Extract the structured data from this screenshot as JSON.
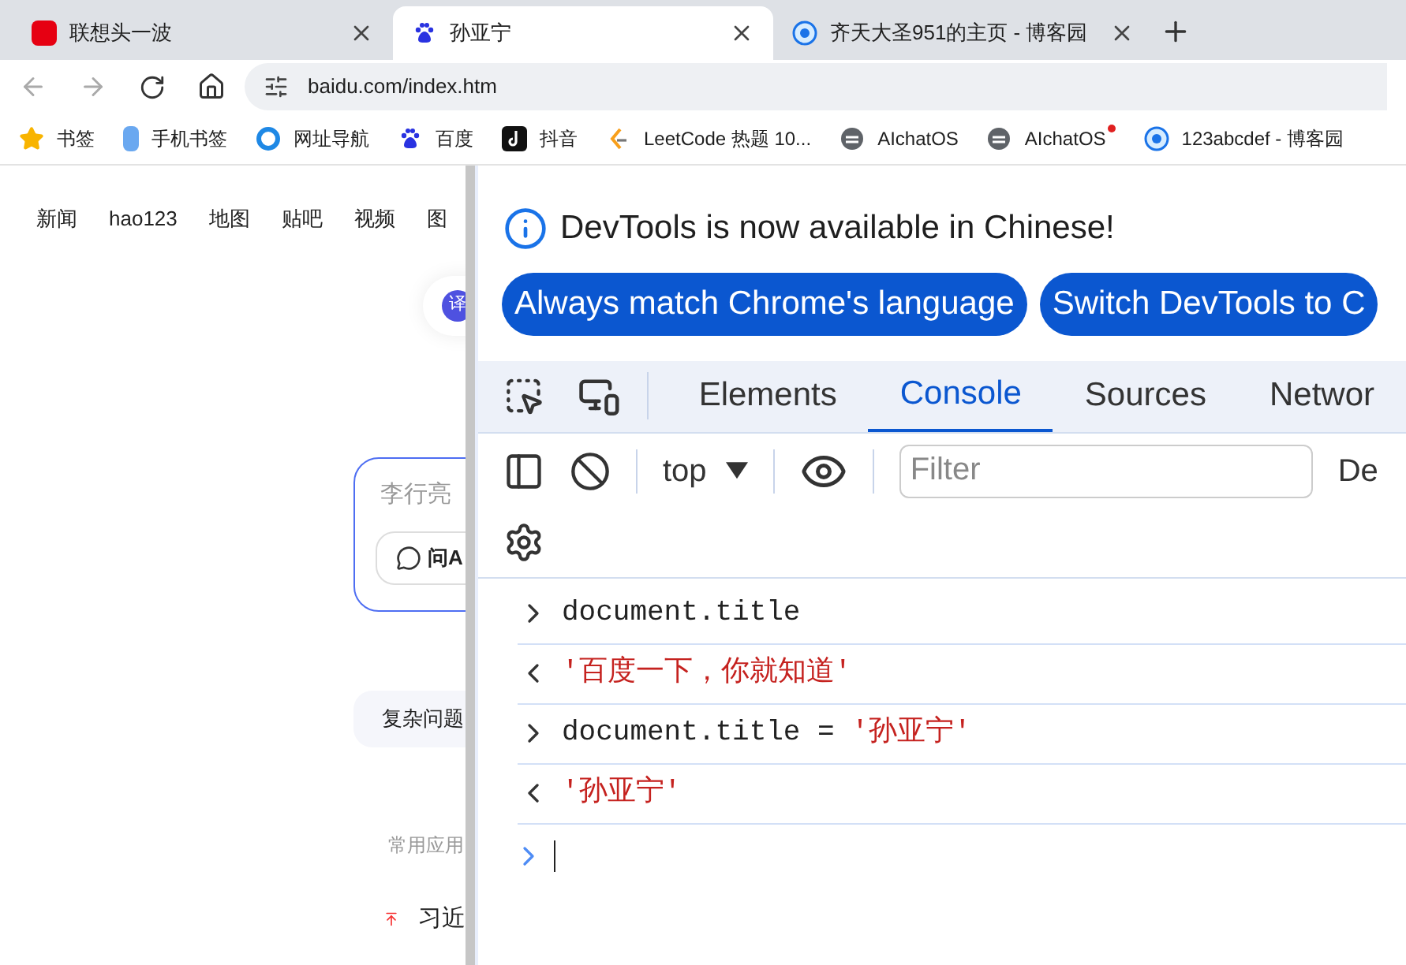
{
  "tabs": [
    {
      "title": "联想头一波",
      "kind": "red-square",
      "selected": false
    },
    {
      "title": "孙亚宁",
      "kind": "paw",
      "selected": true
    },
    {
      "title": "齐天大圣951的主页 - 博客园",
      "kind": "blue-ring",
      "selected": false
    }
  ],
  "address": "baidu.com/index.htm",
  "bookmarks": [
    {
      "label": "书签",
      "kind": "star",
      "dot": false
    },
    {
      "label": "手机书签",
      "kind": "phone",
      "dot": false
    },
    {
      "label": "网址导航",
      "kind": "swirl",
      "dot": false
    },
    {
      "label": "百度",
      "kind": "paw",
      "dot": false
    },
    {
      "label": "抖音",
      "kind": "note",
      "dot": false
    },
    {
      "label": "LeetCode 热题 10...",
      "kind": "bracket",
      "dot": false
    },
    {
      "label": "AIchatOS",
      "kind": "grey-swirl",
      "dot": false
    },
    {
      "label": "AIchatOS",
      "kind": "grey-swirl",
      "dot": true
    },
    {
      "label": "123abcdef - 博客园",
      "kind": "blue-ring",
      "dot": false
    }
  ],
  "page": {
    "nav": [
      "新闻",
      "hao123",
      "地图",
      "贴吧",
      "视频",
      "图"
    ],
    "translate": "译",
    "search": {
      "placeholder": "李行亮",
      "ask_button": "问A"
    },
    "chip": "复杂问题",
    "section_title": "常用应用",
    "hot_item": "习近"
  },
  "devtools": {
    "banner": {
      "message": "DevTools is now available in Chinese!",
      "buttons": [
        "Always match Chrome's language",
        "Switch DevTools to C"
      ]
    },
    "tabs": [
      {
        "label": "Elements",
        "selected": false
      },
      {
        "label": "Console",
        "selected": true
      },
      {
        "label": "Sources",
        "selected": false
      },
      {
        "label": "Networ",
        "selected": false
      }
    ],
    "toolbar": {
      "context": "top",
      "filter_placeholder": "Filter",
      "levels": "De"
    },
    "console": [
      {
        "kind": "input",
        "parts": [
          {
            "text": "document.title",
            "kind": "code"
          }
        ]
      },
      {
        "kind": "output",
        "parts": [
          {
            "text": "'百度一下，你就知道'",
            "kind": "string"
          }
        ]
      },
      {
        "kind": "input",
        "parts": [
          {
            "text": "document.title = ",
            "kind": "code"
          },
          {
            "text": "'孙亚宁'",
            "kind": "string"
          }
        ]
      },
      {
        "kind": "output",
        "parts": [
          {
            "text": "'孙亚宁'",
            "kind": "string"
          }
        ]
      }
    ]
  }
}
